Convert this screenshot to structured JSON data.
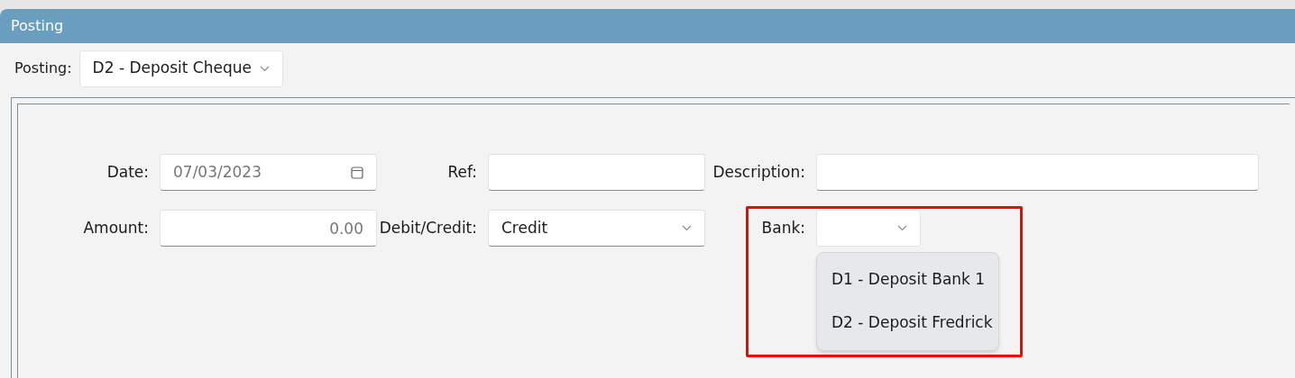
{
  "window": {
    "title": "Posting"
  },
  "posting": {
    "label": "Posting:",
    "value": "D2 - Deposit Cheque"
  },
  "rows": [
    [
      {
        "label": "Date:",
        "kind": "date",
        "placeholder": "07/03/2023"
      },
      {
        "label": "Ref:",
        "kind": "text"
      },
      {
        "label": "Description:",
        "kind": "text"
      }
    ],
    [
      {
        "label": "Amount:",
        "kind": "number",
        "placeholder": "0.00"
      },
      {
        "label": "Debit/Credit:",
        "kind": "select",
        "value": "Credit"
      },
      {
        "label": "Bank:",
        "kind": "select",
        "expanded": true,
        "options": [
          {
            "label": "D1 - Deposit Bank 1",
            "selected": false
          },
          {
            "label": "D2 - Deposit Fredrick",
            "selected": false
          }
        ]
      }
    ]
  ]
}
